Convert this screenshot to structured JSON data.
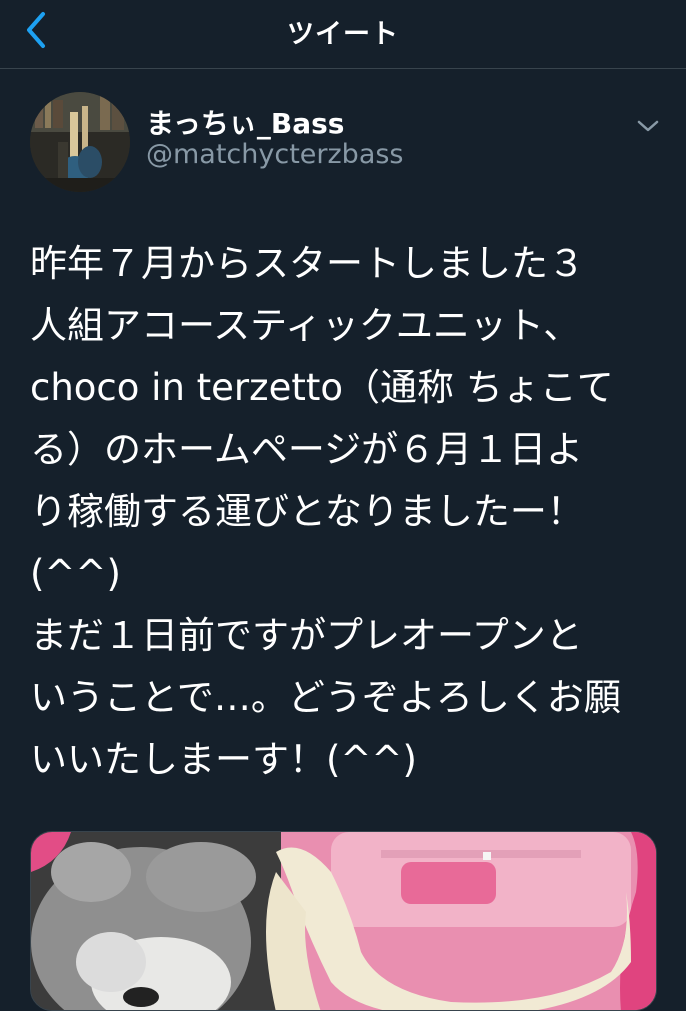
{
  "header": {
    "title": "ツイート",
    "back_icon": "chevron-left-icon"
  },
  "colors": {
    "background": "#15202b",
    "accent": "#1da1f2",
    "secondary_text": "#8899a6",
    "divider": "#38444d"
  },
  "tweet": {
    "author": {
      "display_name": "まっちぃ_Bass",
      "handle": "@matchycterzbass"
    },
    "more_icon": "chevron-down-icon",
    "text_lines": [
      "昨年７月からスタートしました３",
      "人組アコースティックユニット、",
      "choco in terzetto（通称 ちょこて",
      "る）のホームページが６月１日よ",
      "り稼働する運びとなりましたー！",
      "(^^)",
      "まだ１日前ですがプレオープンと",
      "いうことで…。どうぞよろしくお願",
      "いいたしまーす！(^^)"
    ]
  }
}
